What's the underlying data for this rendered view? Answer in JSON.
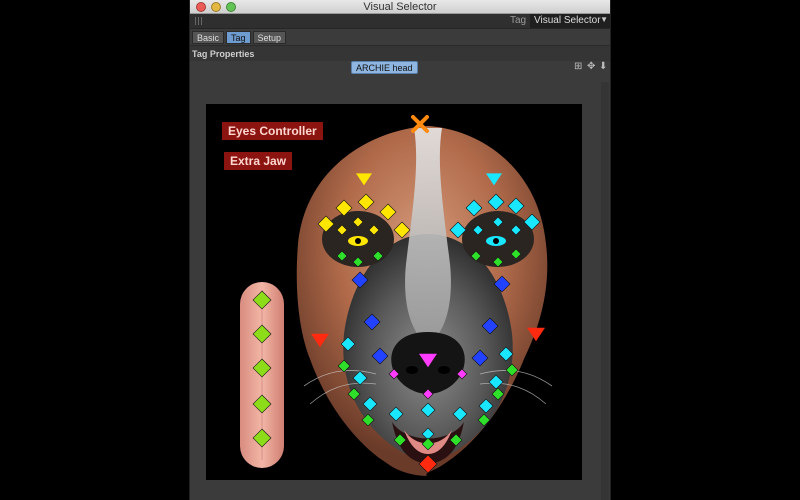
{
  "window": {
    "title": "Visual Selector"
  },
  "tagbar": {
    "label": "Tag",
    "selected": "Visual Selector"
  },
  "tabs": [
    {
      "label": "Basic",
      "active": false
    },
    {
      "label": "Tag",
      "active": true
    },
    {
      "label": "Setup",
      "active": false
    }
  ],
  "panel": {
    "title": "Tag Properties"
  },
  "toolbar": {
    "object_button": "ARCHIE head"
  },
  "canvas": {
    "eyes_controller": "Eyes Controller",
    "extra_jaw": "Extra Jaw"
  },
  "colors": {
    "yellow": "#ffe600",
    "cyan": "#19e6ff",
    "blue": "#2342ff",
    "green": "#2fe02a",
    "magenta": "#ff3cff",
    "red": "#ff2a10",
    "orange": "#ff8a10",
    "lime": "#8ddc1a"
  }
}
